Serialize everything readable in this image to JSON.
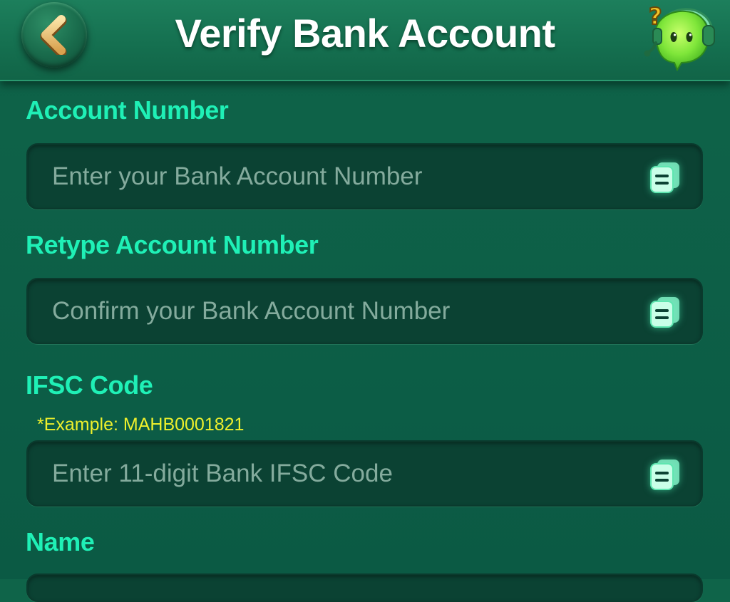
{
  "header": {
    "title": "Verify Bank Account",
    "back_icon": "chevron-left-icon",
    "support_icon": "support-agent-icon",
    "support_badge": "?"
  },
  "form": {
    "account_number": {
      "label": "Account Number",
      "placeholder": "Enter your Bank Account Number",
      "value": "",
      "icon": "copy-icon"
    },
    "retype_account_number": {
      "label": "Retype Account Number",
      "placeholder": "Confirm your Bank Account Number",
      "value": "",
      "icon": "copy-icon"
    },
    "ifsc_code": {
      "label": "IFSC Code",
      "hint": "*Example: MAHB0001821",
      "placeholder": "Enter 11-digit Bank IFSC Code",
      "value": "",
      "icon": "copy-icon"
    },
    "name": {
      "label": "Name"
    }
  },
  "colors": {
    "background": "#0d5f47",
    "header": "#157050",
    "label": "#1ff0b6",
    "hint": "#eef02c",
    "field_background": "#0b4233",
    "placeholder": "#84ab9d",
    "back_arrow": "#f0c879"
  }
}
